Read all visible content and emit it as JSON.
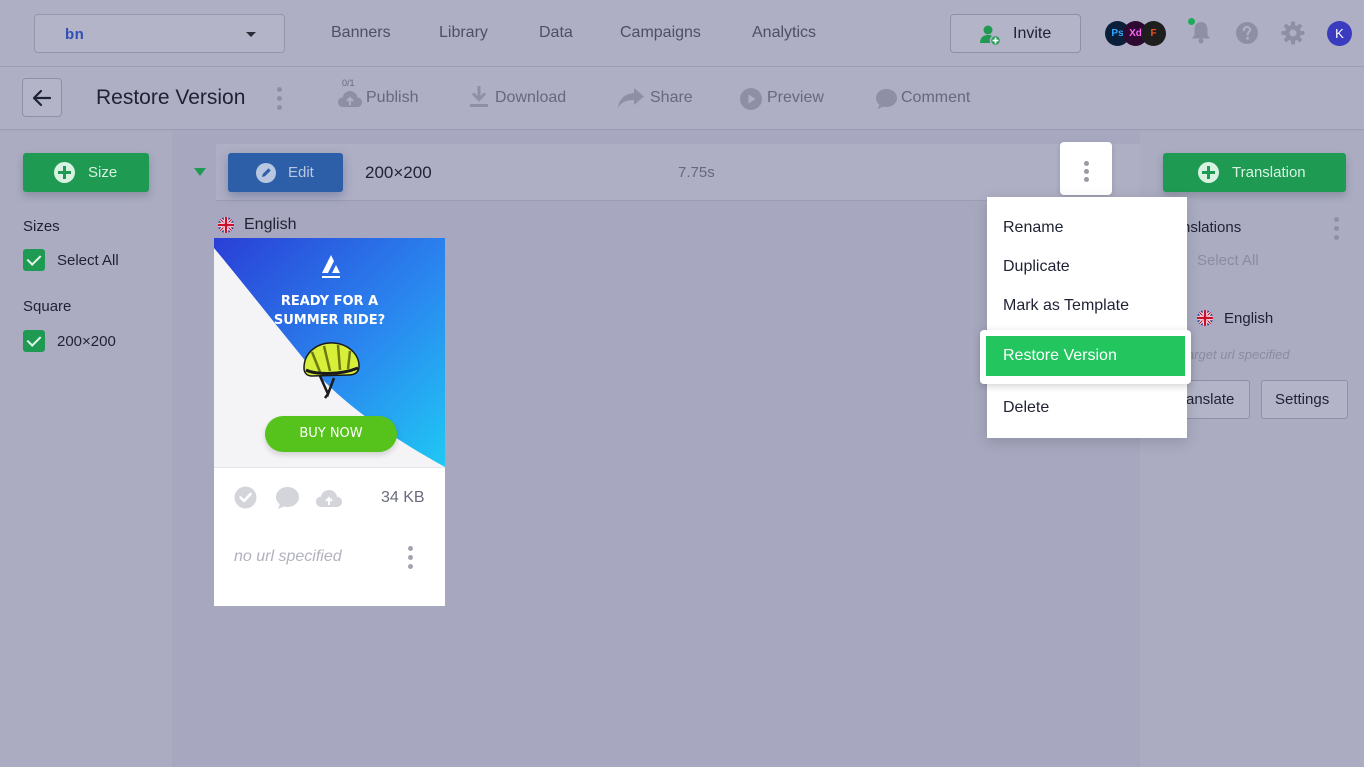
{
  "topbar": {
    "brand_logo": "bn",
    "nav": [
      "Banners",
      "Library",
      "Data",
      "Campaigns",
      "Analytics"
    ],
    "invite_label": "Invite",
    "apps": [
      "Ps",
      "Xd",
      "F"
    ],
    "avatar_initial": "K"
  },
  "toolbar": {
    "page_title": "Restore Version",
    "publish_count": "0/1",
    "publish_label": "Publish",
    "download_label": "Download",
    "share_label": "Share",
    "preview_label": "Preview",
    "comment_label": "Comment"
  },
  "left_panel": {
    "add_size_label": "Size",
    "sizes_heading": "Sizes",
    "select_all_label": "Select All",
    "group_heading": "Square",
    "size_item_label": "200×200"
  },
  "main": {
    "edit_label": "Edit",
    "size_name": "200×200",
    "duration": "7.75s",
    "language": "English",
    "banner": {
      "headline_line1": "READY FOR A",
      "headline_line2": "SUMMER RIDE?",
      "cta": "BUY NOW",
      "file_size": "34 KB",
      "url_placeholder": "no url specified"
    }
  },
  "right_panel": {
    "add_translation_label": "Translation",
    "translations_heading": "nslations",
    "select_all_label": "Select All",
    "language": "English",
    "target_url": "arget url specified",
    "translate_label": "ranslate",
    "settings_label": "Settings"
  },
  "context_menu": {
    "items": [
      "Rename",
      "Duplicate",
      "Mark as Template",
      "Restore Version",
      "Delete"
    ]
  },
  "colors": {
    "accent_green": "#1f9a52",
    "highlight_green": "#22c55e",
    "edit_blue": "#2d5fa8"
  }
}
